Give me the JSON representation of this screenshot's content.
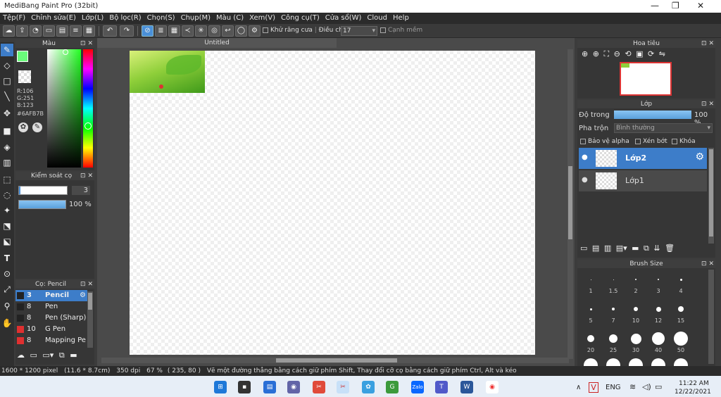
{
  "window": {
    "title": "MediBang Paint Pro (32bit)"
  },
  "menu": [
    "Tệp(F)",
    "Chỉnh sửa(E)",
    "Lớp(L)",
    "Bộ lọc(R)",
    "Chọn(S)",
    "Chụp(M)",
    "Màu (C)",
    "Xem(V)",
    "Công cụ(T)",
    "Cửa sổ(W)",
    "Cloud",
    "Help"
  ],
  "toolbar": {
    "antialias_label": "Khử răng cưa",
    "correction_label": "Điều chỉnh",
    "correction_value": "17",
    "snap_label": "Cạnh mềm"
  },
  "color_panel": {
    "title": "Màu",
    "r": "R:106",
    "g": "G:251",
    "b": "B:123",
    "hex": "#6AFB7B",
    "fg": "#6afb7b"
  },
  "brush_control": {
    "title": "Kiểm soát cọ",
    "size": "3",
    "opacity": "100 %"
  },
  "brush_panel": {
    "title": "Cọ: Pencil",
    "items": [
      {
        "size": "3",
        "name": "Pencil",
        "color": "#222222"
      },
      {
        "size": "8",
        "name": "Pen",
        "color": "#222222"
      },
      {
        "size": "8",
        "name": "Pen (Sharp)",
        "color": "#222222"
      },
      {
        "size": "10",
        "name": "G Pen",
        "color": "#e03030"
      },
      {
        "size": "8",
        "name": "Mapping Pen",
        "color": "#e03030"
      }
    ]
  },
  "canvas": {
    "tab_title": "Untitled"
  },
  "navigator": {
    "title": "Hoa tiêu"
  },
  "layers": {
    "title": "Lớp",
    "opacity_label": "Độ trong",
    "opacity_value": "100 %",
    "blend_label": "Pha trộn",
    "blend_value": "Bình thường",
    "protect_alpha": "Bảo vệ alpha",
    "clipping": "Xén bớt",
    "lock": "Khóa",
    "items": [
      {
        "name": "Lớp2"
      },
      {
        "name": "Lớp1"
      }
    ]
  },
  "brush_size": {
    "title": "Brush Size",
    "rows": [
      [
        {
          "label": "1",
          "d": 1
        },
        {
          "label": "1.5",
          "d": 1
        },
        {
          "label": "2",
          "d": 2
        },
        {
          "label": "3",
          "d": 2
        },
        {
          "label": "4",
          "d": 3
        }
      ],
      [
        {
          "label": "5",
          "d": 3
        },
        {
          "label": "7",
          "d": 4
        },
        {
          "label": "10",
          "d": 6
        },
        {
          "label": "12",
          "d": 7
        },
        {
          "label": "15",
          "d": 8
        }
      ],
      [
        {
          "label": "20",
          "d": 10
        },
        {
          "label": "25",
          "d": 12
        },
        {
          "label": "30",
          "d": 15
        },
        {
          "label": "40",
          "d": 18
        },
        {
          "label": "50",
          "d": 20
        }
      ]
    ]
  },
  "status": {
    "size": "1600 * 1200 pixel",
    "cm": "(11.6 * 8.7cm)",
    "dpi": "350 dpi",
    "zoom": "67 %",
    "coords": "( 235, 80 )",
    "hint": "Vẽ một đường thẳng bằng cách giữ phím Shift, Thay đổi cỡ cọ bằng cách giữ phím Ctrl, Alt và kéo"
  },
  "taskbar": {
    "lang": "ENG",
    "time": "11:22 AM",
    "date": "12/22/2021"
  }
}
